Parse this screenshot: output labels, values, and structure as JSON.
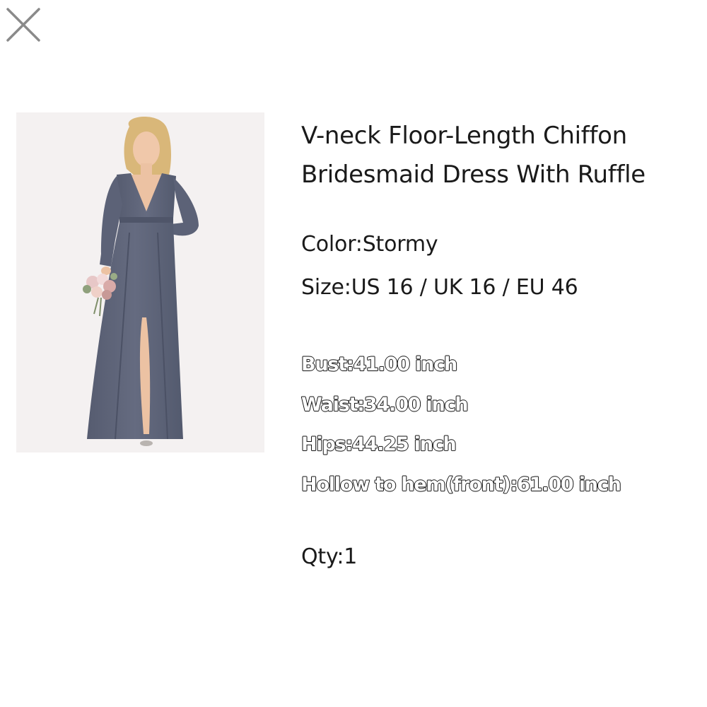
{
  "close": {
    "icon": "close-icon"
  },
  "product": {
    "image_alt": "Woman in long-sleeve V-neck chiffon dress holding a bouquet",
    "title_line1": "V-neck Floor-Length Chiffon",
    "title_line2": "Bridesmaid Dress With Ruffle",
    "color": "Color:Stormy",
    "size": "Size:US 16 / UK 16 / EU 46",
    "measurements": {
      "bust": "Bust:41.00 inch",
      "waist": "Waist:34.00 inch",
      "hips": "Hips:44.25 inch",
      "hollow": "Hollow to hem(front):61.00 inch"
    },
    "qty": "Qty:1"
  },
  "colors": {
    "dress": "#5f6579",
    "image_bg": "#f4f1f1",
    "text": "#1a1a1a",
    "close_icon": "#888888"
  }
}
